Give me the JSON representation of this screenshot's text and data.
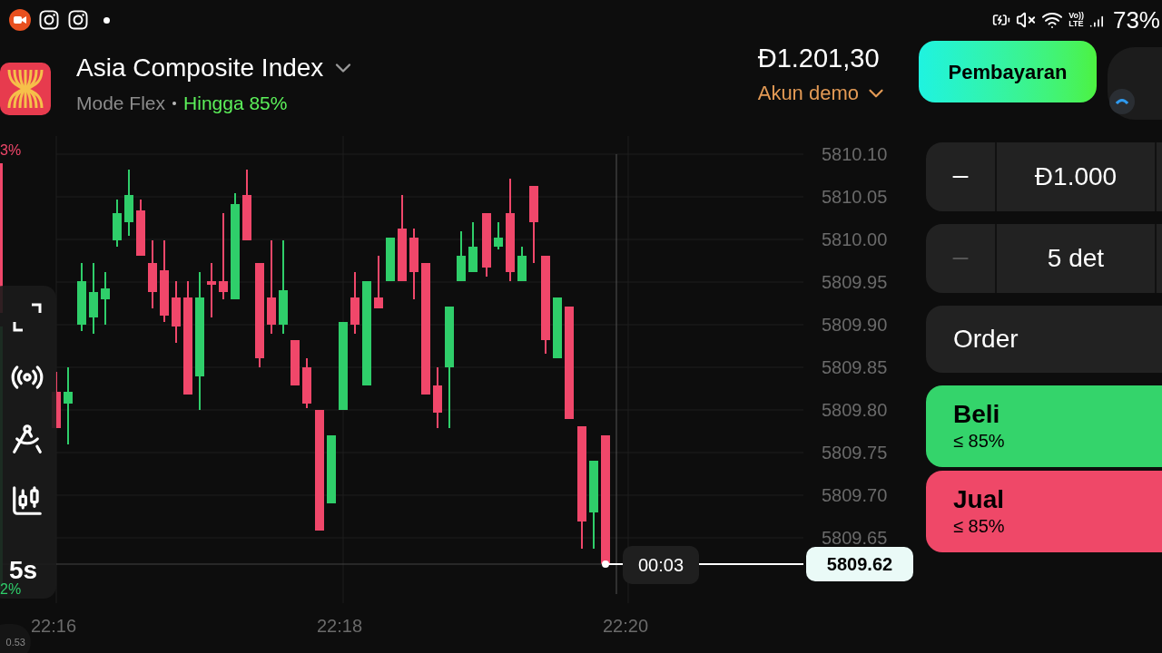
{
  "status_bar": {
    "network": [
      "Vo))",
      "LTE"
    ],
    "battery": "73%"
  },
  "asset": {
    "name": "Asia Composite Index",
    "mode": "Mode Flex",
    "payout": "Hingga 85%"
  },
  "account": {
    "balance": "Đ1.201,30",
    "type": "Akun demo"
  },
  "deposit_button": "Pembayaran",
  "chart": {
    "y_labels": [
      "5810.10",
      "5810.05",
      "5810.00",
      "5809.95",
      "5809.90",
      "5809.85",
      "5809.80",
      "5809.75",
      "5809.70",
      "5809.65"
    ],
    "x_labels": [
      "22:16",
      "22:18",
      "22:20"
    ],
    "timer": "00:03",
    "current_price": "5809.62",
    "sentiment": {
      "up": "3%",
      "down": "2%"
    },
    "interval": "5s",
    "footer_value": "0.53"
  },
  "trade": {
    "rows": [
      {
        "value": "Đ1.000",
        "disabled": false
      },
      {
        "value": "5 det",
        "disabled": true
      }
    ],
    "order_label": "Order",
    "buttons": [
      {
        "kind": "buy",
        "label": "Beli",
        "payout": "≤ 85%"
      },
      {
        "kind": "sell",
        "label": "Jual",
        "payout": "≤ 85%"
      }
    ]
  }
}
